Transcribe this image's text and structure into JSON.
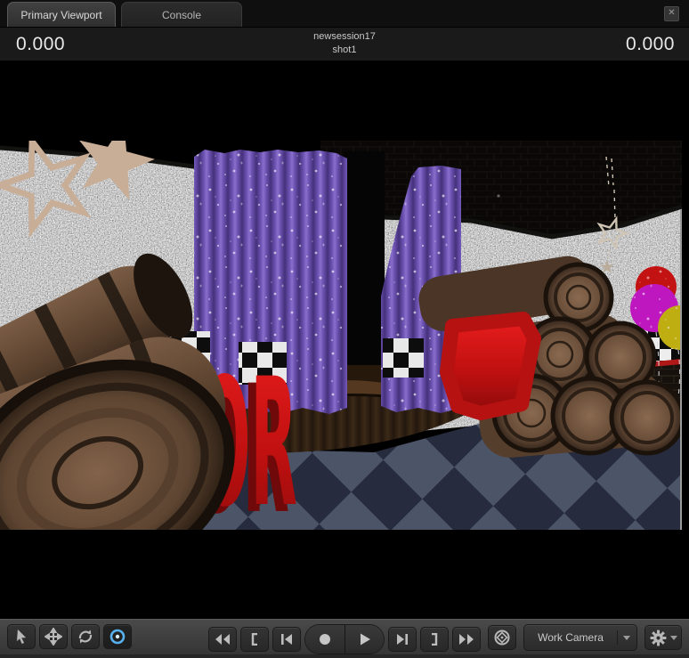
{
  "tabs": [
    {
      "label": "Primary Viewport",
      "active": true
    },
    {
      "label": "Console",
      "active": false
    }
  ],
  "window": {
    "close_glyph": "✕"
  },
  "header": {
    "left_value": "0.000",
    "right_value": "0.000",
    "session_name": "newsession17",
    "shot_name": "shot1"
  },
  "viewport": {
    "scene": {
      "error_text": "ERROR"
    }
  },
  "toolbar": {
    "tools": [
      {
        "name": "select"
      },
      {
        "name": "translate"
      },
      {
        "name": "rotate"
      },
      {
        "name": "orbit",
        "active": true
      }
    ],
    "transport": [
      "rewind",
      "loop-start",
      "step-back",
      "record",
      "play",
      "step-forward",
      "loop-end",
      "fast-forward"
    ],
    "camera_selector": {
      "value": "Work Camera"
    },
    "settings_icon": "gear"
  },
  "colors": {
    "accent_blue": "#58b1ef",
    "error_red": "#c41414",
    "curtain_purple": "#6c51ad",
    "floor_light": "#4d5568",
    "floor_dark": "#272d3d",
    "star_tan": "#c9ae97"
  }
}
